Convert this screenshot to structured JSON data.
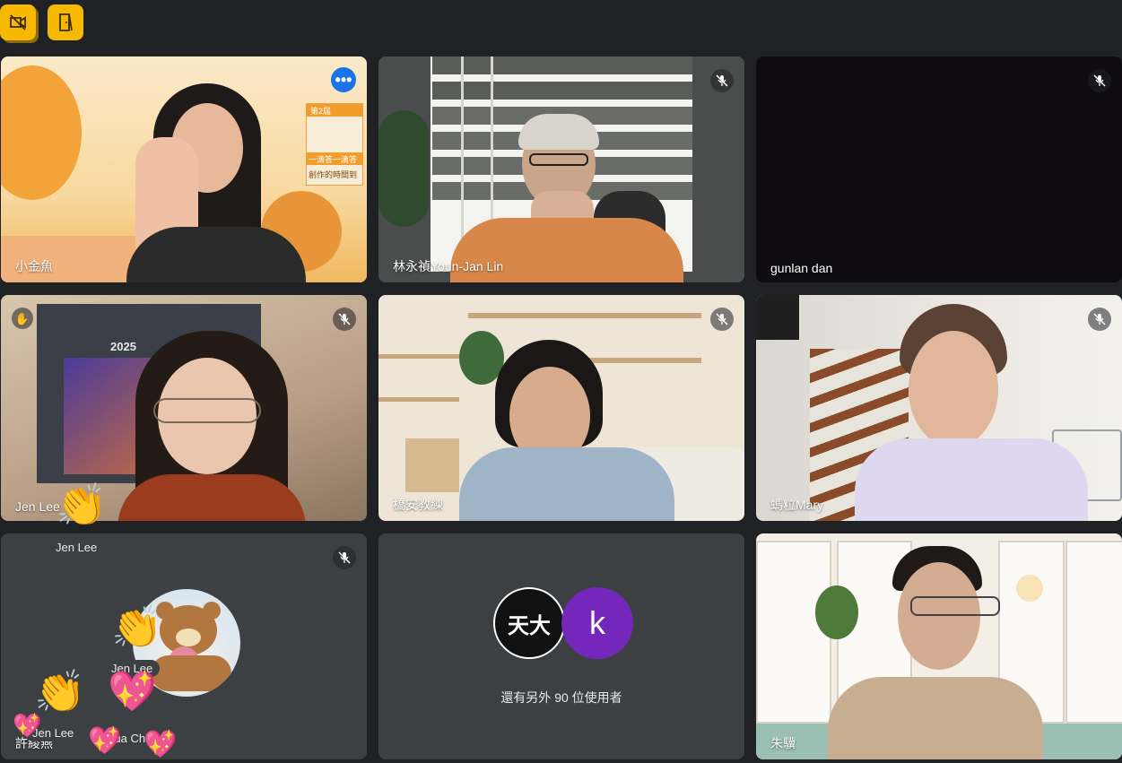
{
  "toolbar": {
    "left_icon": "camera-off-icon",
    "right_icon": "door-exit-icon"
  },
  "participants": [
    {
      "name": "小金魚",
      "muted": false,
      "more_menu": "•••"
    },
    {
      "name": "林永禎Youn-Jan Lin",
      "muted": true
    },
    {
      "name": "gunlan dan",
      "muted": true
    },
    {
      "name": "Jen Lee",
      "muted": true,
      "hand_raised": true
    },
    {
      "name": "橋安教練",
      "muted": true
    },
    {
      "name": "螞粒Mary",
      "muted": true
    },
    {
      "name": "許綾燕",
      "muted": true
    },
    {
      "name": "朱驥",
      "muted": false
    }
  ],
  "overflow": {
    "text": "還有另外 90 位使用者",
    "avatar_letter": "k",
    "avatar_color": "#7627bb",
    "logo_text": "天大"
  },
  "tile1_sign": {
    "badge": "第2屆",
    "line1": "一滴答一滴答",
    "line2": "創作的時間到"
  },
  "tile4_box_label": "2025",
  "reactions": {
    "tag1": "Jen Lee",
    "tag2": "Jen Lee",
    "tag3": "Jen Lee",
    "tag4": "Hua Chou"
  },
  "colors": {
    "background": "#202124",
    "tile": "#3c4043",
    "active_border": "#8ab4f8",
    "accent_yellow": "#f6b900"
  }
}
